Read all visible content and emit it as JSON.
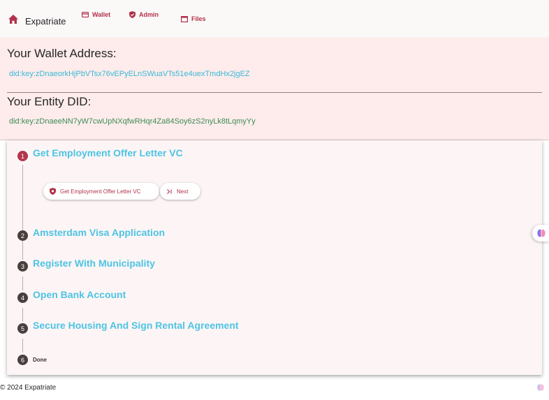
{
  "nav": {
    "home_icon": "home-icon",
    "app_title": "Expatriate",
    "links": [
      {
        "label": "Wallet",
        "icon": "wallet-icon"
      },
      {
        "label": "Admin",
        "icon": "shield-check-icon"
      },
      {
        "label": "Files",
        "icon": "window-icon"
      }
    ]
  },
  "wallet": {
    "heading": "Your Wallet Address:",
    "did": "did:key:zDnaeorkHjPbVTsx76vEPyELnSWuaVTs51e4uexTmdHx2jgEZ"
  },
  "entity": {
    "heading": "Your Entity DID:",
    "did": "did:key:zDnaeeNN7yW7cwUpNXqfwRHqr4Za84Soy6zS2nyLk8tLqmyYy"
  },
  "stepper": {
    "active_step": 1,
    "steps": [
      {
        "number": "1",
        "title": "Get Employment Offer Letter VC"
      },
      {
        "number": "2",
        "title": "Amsterdam Visa Application"
      },
      {
        "number": "3",
        "title": "Register With Municipality"
      },
      {
        "number": "4",
        "title": "Open Bank Account"
      },
      {
        "number": "5",
        "title": "Secure Housing And Sign Rental Agreement"
      },
      {
        "number": "6",
        "title": "Done"
      }
    ],
    "actions": {
      "primary_label": "Get Employment Offer Letter VC",
      "next_label": "Next"
    }
  },
  "footer": {
    "copyright": "© 2024 Expatriate"
  },
  "colors": {
    "accent": "#b0324a",
    "link_blue": "#4cc4e4",
    "did_green": "#3f8a56",
    "panel_bg": "#fdeceb",
    "step_idle": "#4a3e3e"
  }
}
